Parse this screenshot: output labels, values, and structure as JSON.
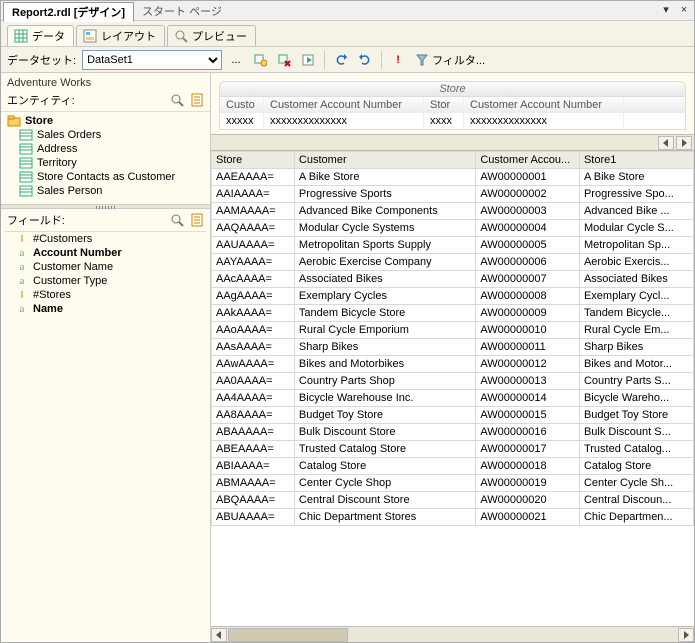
{
  "titlebar": {
    "active_tab": "Report2.rdl [デザイン]",
    "inactive_tab": "スタート ページ",
    "dropdown_tooltip": "▾",
    "close_tooltip": "×"
  },
  "ribbon": {
    "tabs": [
      {
        "icon": "grid",
        "label": "データ"
      },
      {
        "icon": "layout",
        "label": "レイアウト"
      },
      {
        "icon": "preview",
        "label": "プレビュー"
      }
    ],
    "active_index": 0
  },
  "toolbar": {
    "dataset_label": "データセット:",
    "dataset_value": "DataSet1",
    "ellipsis": "...",
    "filter_label": "フィルタ..."
  },
  "left": {
    "adventure": "Adventure Works",
    "entity_label": "エンティティ:",
    "tree": [
      {
        "label": "Store",
        "root": true,
        "icon": "folder"
      },
      {
        "label": "Sales Orders",
        "root": false,
        "icon": "table"
      },
      {
        "label": "Address",
        "root": false,
        "icon": "table"
      },
      {
        "label": "Territory",
        "root": false,
        "icon": "table"
      },
      {
        "label": "Store Contacts as Customer",
        "root": false,
        "icon": "table"
      },
      {
        "label": "Sales Person",
        "root": false,
        "icon": "table"
      }
    ],
    "fields_label": "フィールド:",
    "fields": [
      {
        "kind": "num",
        "label": "#Customers",
        "bold": false
      },
      {
        "kind": "text",
        "label": "Account Number",
        "bold": true
      },
      {
        "kind": "text",
        "label": "Customer Name",
        "bold": false
      },
      {
        "kind": "text",
        "label": "Customer Type",
        "bold": false
      },
      {
        "kind": "num",
        "label": "#Stores",
        "bold": false
      },
      {
        "kind": "text",
        "label": "Name",
        "bold": true
      }
    ]
  },
  "store_panel": {
    "title": "Store",
    "headers": [
      "Custo",
      "Customer Account Number",
      "Stor",
      "Customer Account Number"
    ],
    "row": [
      "xxxxx",
      "xxxxxxxxxxxxxx",
      "xxxx",
      "xxxxxxxxxxxxxx"
    ]
  },
  "grid": {
    "columns": [
      "Store",
      "Customer",
      "Customer Accou...",
      "Store1"
    ],
    "rows": [
      [
        "AAEAAAA=",
        "A Bike Store",
        "AW00000001",
        "A Bike Store"
      ],
      [
        "AAIAAAA=",
        "Progressive Sports",
        "AW00000002",
        "Progressive Spo..."
      ],
      [
        "AAMAAAA=",
        "Advanced Bike Components",
        "AW00000003",
        "Advanced Bike ..."
      ],
      [
        "AAQAAAA=",
        "Modular Cycle Systems",
        "AW00000004",
        "Modular Cycle S..."
      ],
      [
        "AAUAAAA=",
        "Metropolitan Sports Supply",
        "AW00000005",
        "Metropolitan Sp..."
      ],
      [
        "AAYAAAA=",
        "Aerobic Exercise Company",
        "AW00000006",
        "Aerobic Exercis..."
      ],
      [
        "AAcAAAA=",
        "Associated Bikes",
        "AW00000007",
        "Associated Bikes"
      ],
      [
        "AAgAAAA=",
        "Exemplary Cycles",
        "AW00000008",
        "Exemplary Cycl..."
      ],
      [
        "AAkAAAA=",
        "Tandem Bicycle Store",
        "AW00000009",
        "Tandem Bicycle..."
      ],
      [
        "AAoAAAA=",
        "Rural Cycle Emporium",
        "AW00000010",
        "Rural Cycle Em..."
      ],
      [
        "AAsAAAA=",
        "Sharp Bikes",
        "AW00000011",
        "Sharp Bikes"
      ],
      [
        "AAwAAAA=",
        "Bikes and Motorbikes",
        "AW00000012",
        "Bikes and Motor..."
      ],
      [
        "AA0AAAA=",
        "Country Parts Shop",
        "AW00000013",
        "Country Parts S..."
      ],
      [
        "AA4AAAA=",
        "Bicycle Warehouse Inc.",
        "AW00000014",
        "Bicycle Wareho..."
      ],
      [
        "AA8AAAA=",
        "Budget Toy Store",
        "AW00000015",
        "Budget Toy Store"
      ],
      [
        "ABAAAAA=",
        "Bulk Discount Store",
        "AW00000016",
        "Bulk Discount S..."
      ],
      [
        "ABEAAAA=",
        "Trusted Catalog Store",
        "AW00000017",
        "Trusted Catalog..."
      ],
      [
        "ABIAAAA=",
        "Catalog Store",
        "AW00000018",
        "Catalog Store"
      ],
      [
        "ABMAAAA=",
        "Center Cycle Shop",
        "AW00000019",
        "Center Cycle Sh..."
      ],
      [
        "ABQAAAA=",
        "Central Discount Store",
        "AW00000020",
        "Central Discoun..."
      ],
      [
        "ABUAAAA=",
        "Chic Department Stores",
        "AW00000021",
        "Chic Departmen..."
      ]
    ]
  }
}
